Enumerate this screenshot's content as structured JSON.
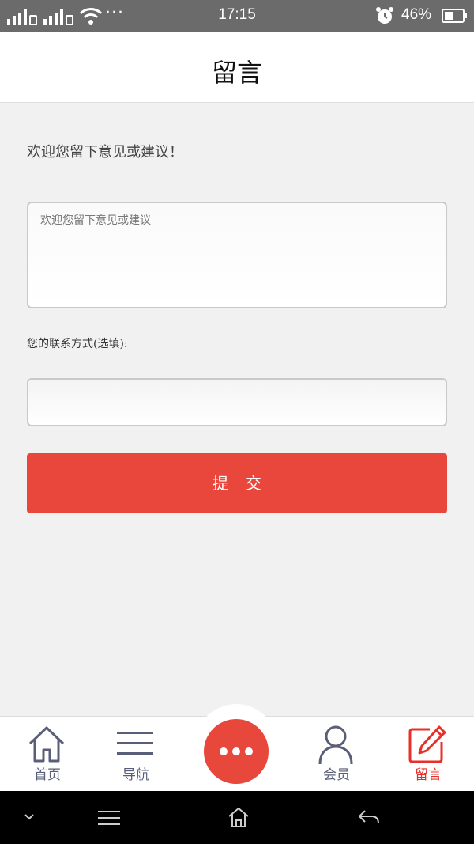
{
  "status_bar": {
    "time": "17:15",
    "battery": "46%",
    "icons": [
      "signal-icon",
      "signal-2-icon",
      "wifi-icon",
      "more-dots-icon",
      "alarm-icon",
      "battery-icon"
    ],
    "more": "···"
  },
  "header": {
    "title": "留言"
  },
  "form": {
    "intro": "欢迎您留下意见或建议！",
    "message_placeholder": "欢迎您留下意见或建议",
    "contact_label": "您的联系方式(选填):",
    "contact_value": "",
    "submit_label": "提交"
  },
  "tab_bar": {
    "tabs": [
      {
        "label": "首页",
        "icon": "home-icon"
      },
      {
        "label": "导航",
        "icon": "menu-icon"
      },
      {
        "label": "",
        "icon": "more-dots-icon"
      },
      {
        "label": "会员",
        "icon": "user-icon"
      },
      {
        "label": "留言",
        "icon": "edit-icon",
        "active": true
      }
    ]
  },
  "colors": {
    "accent": "#e9473b",
    "active_tab": "#e8302b",
    "tab_text": "#5a5e79",
    "status_bar": "#6b6b6b",
    "background": "#f1f1f1"
  },
  "system_nav": {
    "icons": [
      "chevron-down-icon",
      "menu-lines-icon",
      "home-outline-icon",
      "back-icon"
    ]
  }
}
